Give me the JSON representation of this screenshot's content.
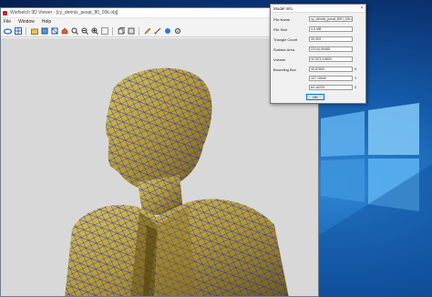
{
  "app": {
    "title": "Wiefsetch 3D Viewer - [cy_dennis_pesat_80_00k.obj]",
    "menu": [
      "File",
      "Window",
      "Help"
    ],
    "toolbar_icons": [
      "view-orientation-icon",
      "grid-icon",
      "open-icon",
      "cube-solid-icon",
      "cube-wire-icon",
      "home-icon",
      "zoom-in-icon",
      "zoom-out-icon",
      "zoom-fit-icon",
      "zoom-window-icon",
      "box-icon",
      "bounding-box-icon",
      "edit-icon",
      "measure-icon",
      "sphere-icon",
      "settings-icon"
    ]
  },
  "dialog": {
    "title": "Model Info",
    "close": "×",
    "rows": [
      {
        "label": "File Name",
        "value": "cy_dennis_pesat_80H_00k.obj"
      },
      {
        "label": "File Size",
        "value": "4.6 MB"
      },
      {
        "label": "Triangle Count",
        "value": "39,993"
      },
      {
        "label": "Surface Area",
        "value": "23144.09465"
      },
      {
        "label": "Volume",
        "value": "117671.19820"
      },
      {
        "label": "Bounding Box",
        "value": "40.87600"
      }
    ],
    "bbox_extra": [
      "107.15940",
      "64.16220"
    ],
    "axes": [
      "X",
      "Y",
      "Z"
    ],
    "ok_label": "OK"
  },
  "colors": {
    "model_fill": "#b9a23a",
    "mesh_lines": "#1f2bd0",
    "viewport_bg": "#d8d8d8",
    "desktop_accent": "#2f88d6"
  }
}
